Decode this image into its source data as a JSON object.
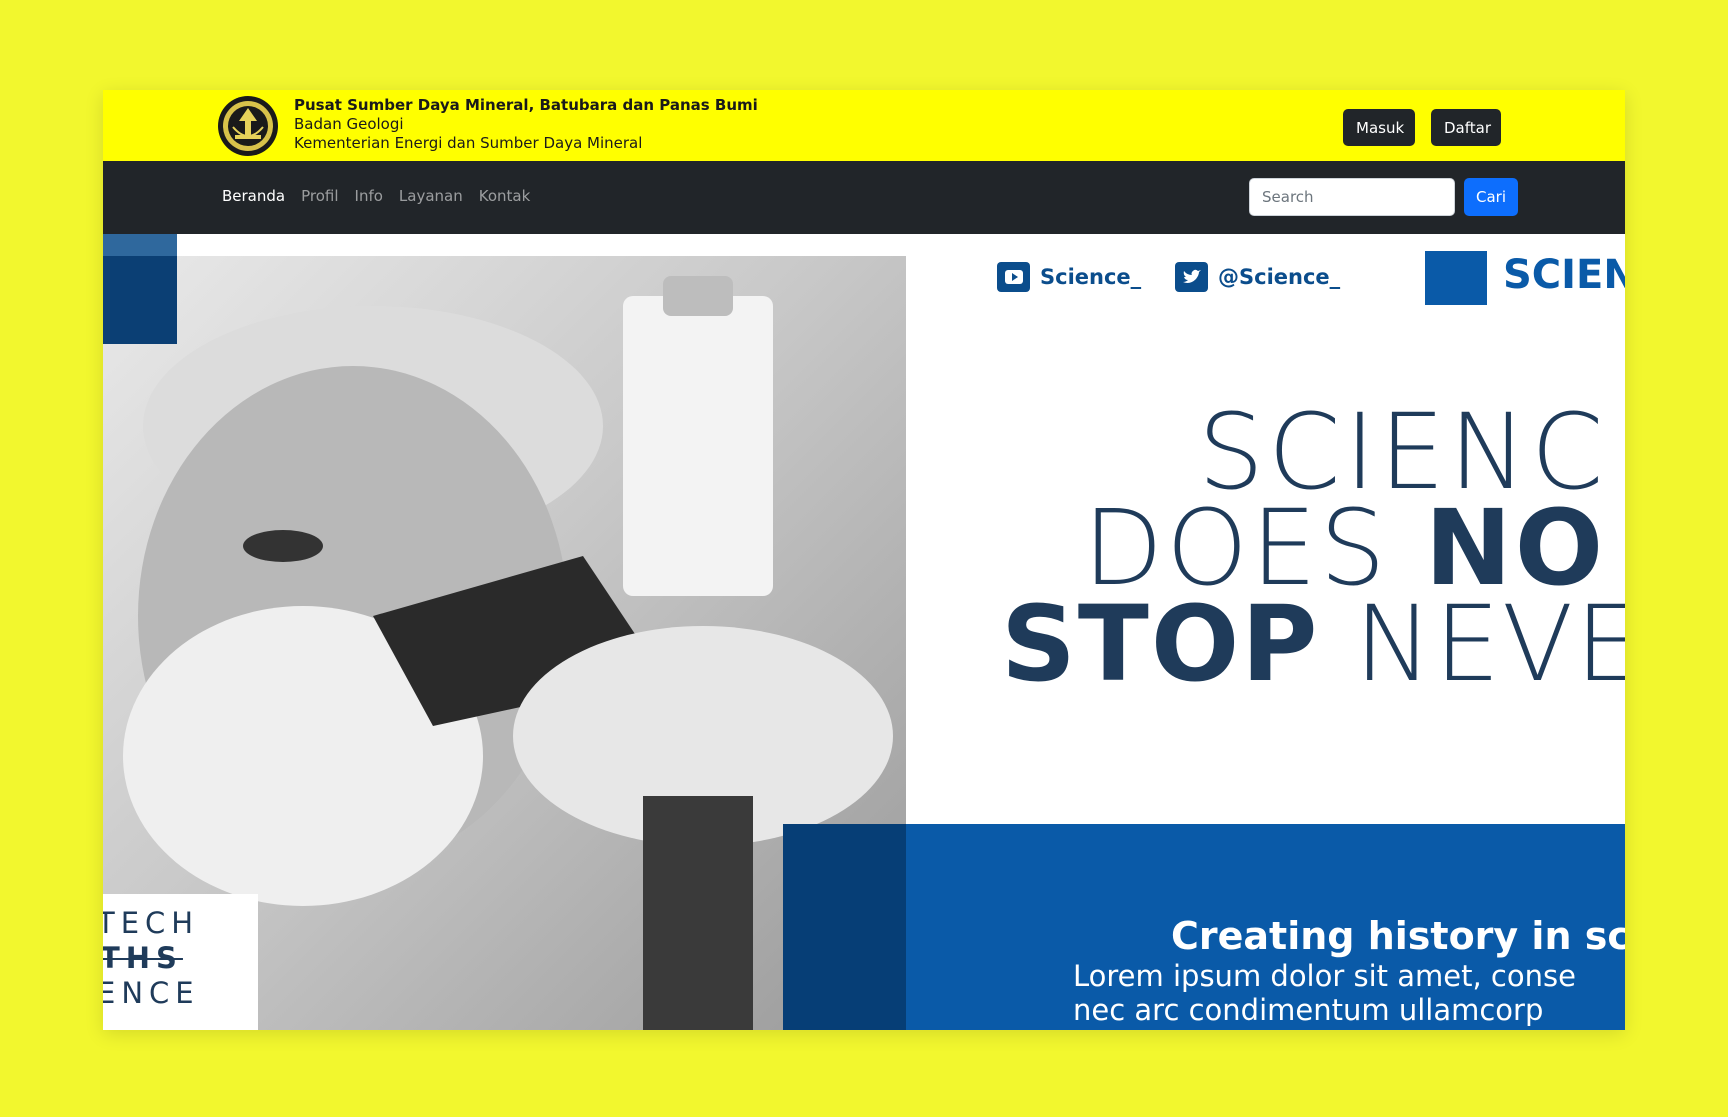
{
  "header": {
    "org_name": "Pusat Sumber Daya Mineral, Batubara dan Panas Bumi",
    "org_sub1": "Badan Geologi",
    "org_sub2": "Kementerian Energi dan Sumber Daya Mineral",
    "login_label": "Masuk",
    "register_label": "Daftar",
    "logo_icon": "government-emblem-icon"
  },
  "nav": {
    "items": [
      "Beranda",
      "Profil",
      "Info",
      "Layanan",
      "Kontak"
    ],
    "active": "Beranda",
    "search_placeholder": "Search",
    "search_button": "Cari"
  },
  "hero": {
    "social_youtube": "Science_",
    "social_twitter": "@Science_",
    "brand": "SCIEN",
    "headline_1": "SCIENC",
    "headline_2a": "DOES ",
    "headline_2b": "NO",
    "headline_3a": "STOP",
    "headline_3b": " NEVE",
    "tagline": "Creating history in sci",
    "lorem_1": "Lorem ipsum dolor sit amet, conse",
    "lorem_2": "nec arc condimentum ullamcorp",
    "label_1": "TECH",
    "label_2": "YTHS",
    "label_3": "ENCE"
  },
  "colors": {
    "page_bg": "#f2f72e",
    "header_bg": "#ffff00",
    "nav_bg": "#212529",
    "primary": "#0d6efd",
    "hero_blue": "#0a5aa8",
    "hero_text": "#1f3b5a"
  }
}
